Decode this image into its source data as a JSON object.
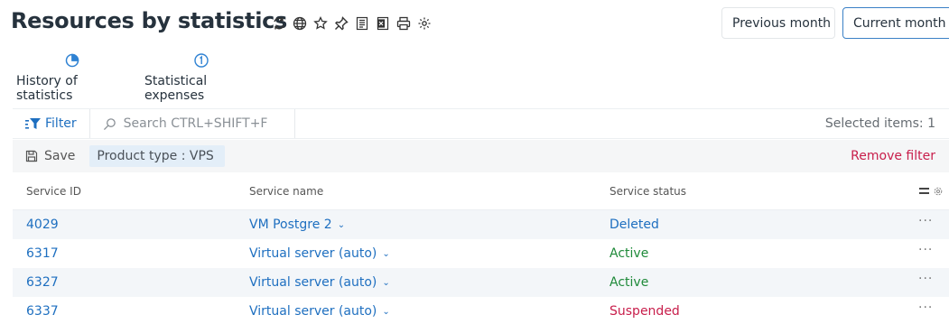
{
  "page": {
    "title": "Resources by statistics",
    "toolbar_icons": [
      "refresh-icon",
      "globe-icon",
      "star-icon",
      "pin-icon",
      "report-icon",
      "excel-export-icon",
      "print-icon",
      "settings-icon"
    ]
  },
  "period": {
    "previous_label": "Previous month",
    "current_label": "Current month"
  },
  "tabs": [
    {
      "label": "History of statistics",
      "icon": "pie-chart-icon"
    },
    {
      "label": "Statistical expenses",
      "icon": "number-one-icon"
    }
  ],
  "filter": {
    "button_label": "Filter",
    "search_placeholder": "Search CTRL+SHIFT+F",
    "selected_label": "Selected items: 1",
    "save_label": "Save",
    "active_chip": "Product type : VPS",
    "remove_label": "Remove filter"
  },
  "table": {
    "columns": [
      "Service ID",
      "Service name",
      "Service status"
    ],
    "rows": [
      {
        "id": "4029",
        "name": "VM Postgre 2",
        "status": "Deleted"
      },
      {
        "id": "6317",
        "name": "Virtual server (auto)",
        "status": "Active"
      },
      {
        "id": "6327",
        "name": "Virtual server (auto)",
        "status": "Active"
      },
      {
        "id": "6337",
        "name": "Virtual server (auto)",
        "status": "Suspended"
      }
    ],
    "row_menu": "···"
  },
  "colors": {
    "accent": "#1e6fc0",
    "active": "#1f8a3a",
    "danger": "#c81e4b"
  }
}
